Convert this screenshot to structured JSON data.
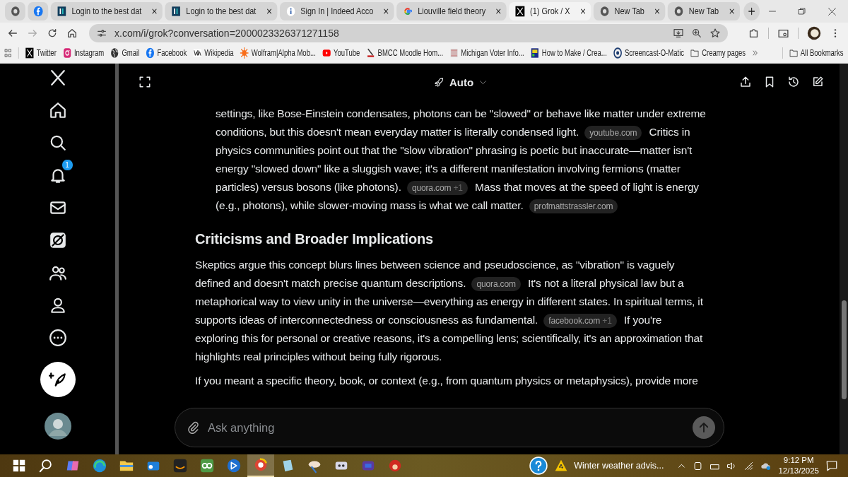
{
  "browser": {
    "tabs": [
      {
        "kind": "pinned",
        "selected": false
      },
      {
        "kind": "pinned",
        "selected": false
      },
      {
        "kind": "tab",
        "title": "Login to the best dat",
        "selected": false
      },
      {
        "kind": "tab",
        "title": "Login to the best dat",
        "selected": false
      },
      {
        "kind": "tab",
        "title": "Sign In | Indeed Acco",
        "selected": false
      },
      {
        "kind": "tab",
        "title": "Liouville field theory",
        "selected": false
      },
      {
        "kind": "tab",
        "title": "(1) Grok / X",
        "selected": true
      },
      {
        "kind": "tab",
        "title": "New Tab",
        "selected": false
      },
      {
        "kind": "tab",
        "title": "New Tab",
        "selected": false
      }
    ],
    "address": "x.com/i/grok?conversation=2000023326371271158",
    "bookmarks": [
      {
        "kind": "link",
        "label": "Twitter"
      },
      {
        "kind": "link",
        "label": "Instagram"
      },
      {
        "kind": "link",
        "label": "Gmail"
      },
      {
        "kind": "link",
        "label": "Facebook"
      },
      {
        "kind": "link",
        "label": "Wikipedia"
      },
      {
        "kind": "link",
        "label": "Wolfram|Alpha Mob..."
      },
      {
        "kind": "link",
        "label": "YouTube"
      },
      {
        "kind": "link",
        "label": "BMCC Moodle Hom..."
      },
      {
        "kind": "link",
        "label": "Michigan Voter Info..."
      },
      {
        "kind": "link",
        "label": "How to Make / Crea..."
      },
      {
        "kind": "link",
        "label": "Screencast-O-Matic"
      },
      {
        "kind": "folder",
        "label": "Creamy pages"
      }
    ],
    "all_bookmarks": "All Bookmarks"
  },
  "sidebar": {
    "notification_badge": "1"
  },
  "header": {
    "mode": "Auto"
  },
  "conversation": {
    "blocks": [
      {
        "kind": "list_paragraph",
        "segments": [
          {
            "kind": "text",
            "text": "settings, like Bose-Einstein condensates, photons can be \"slowed\" or behave like matter under extreme conditions, but this doesn't mean everyday matter is literally condensed light."
          },
          {
            "kind": "source",
            "text": "youtube.com"
          },
          {
            "kind": "text",
            "text": "Critics in physics communities point out that the \"slow vibration\" phrasing is poetic but inaccurate—matter isn't energy \"slowed down\" like a sluggish wave; it's a different manifestation involving fermions (matter particles) versus bosons (like photons)."
          },
          {
            "kind": "source",
            "text": "quora.com",
            "more": "+1"
          },
          {
            "kind": "text",
            "text": "Mass that moves at the speed of light is energy (e.g., photons), while slower-moving mass is what we call matter."
          },
          {
            "kind": "source",
            "text": "profmattstrassler.com"
          }
        ]
      },
      {
        "kind": "heading",
        "text": "Criticisms and Broader Implications"
      },
      {
        "kind": "paragraph",
        "segments": [
          {
            "kind": "text",
            "text": "Skeptics argue this concept blurs lines between science and pseudoscience, as \"vibration\" is vaguely defined and doesn't match precise quantum descriptions."
          },
          {
            "kind": "source",
            "text": "quora.com"
          },
          {
            "kind": "text",
            "text": "It's not a literal physical law but a metaphorical way to view unity in the universe—everything as energy in different states. In spiritual terms, it supports ideas of interconnectedness or consciousness as fundamental."
          },
          {
            "kind": "source",
            "text": "facebook.com",
            "more": "+1"
          },
          {
            "kind": "text",
            "text": "If you're exploring this for personal or creative reasons, it's a compelling lens; scientifically, it's an approximation that highlights real principles without being fully rigorous."
          }
        ]
      },
      {
        "kind": "partial_line",
        "text": "If you meant a specific theory, book, or context (e.g., from quantum physics or metaphysics), provide more"
      }
    ]
  },
  "composer": {
    "placeholder": "Ask anything"
  },
  "taskbar": {
    "weather": "Winter weather advis...",
    "time": "9:12 PM",
    "date": "12/13/2025"
  }
}
